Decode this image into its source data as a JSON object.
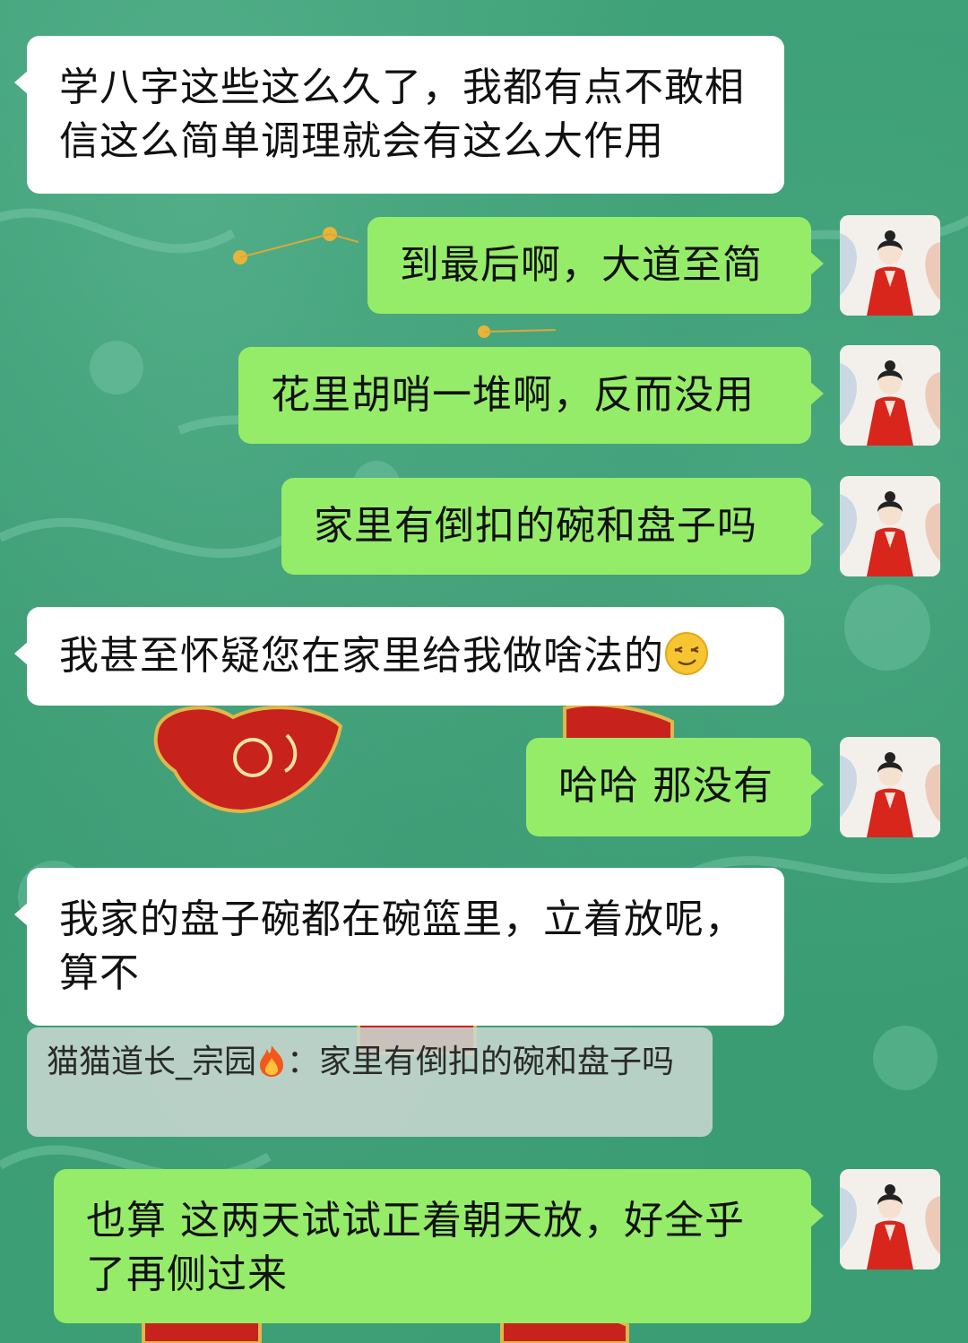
{
  "chat": {
    "messages": [
      {
        "side": "left",
        "text": "学八字这些这么久了，我都有点不敢相信这么简单调理就会有这么大作用"
      },
      {
        "side": "right",
        "text": "到最后啊，大道至简"
      },
      {
        "side": "right",
        "text": "花里胡哨一堆啊，反而没用"
      },
      {
        "side": "right",
        "text": "家里有倒扣的碗和盘子吗"
      },
      {
        "side": "left",
        "text": "我甚至怀疑您在家里给我做啥法的",
        "emoji": "smirk-emoji"
      },
      {
        "side": "right",
        "text": "哈哈 那没有"
      },
      {
        "side": "left",
        "text": "我家的盘子碗都在碗篮里，立着放呢，算不"
      },
      {
        "side": "right",
        "text": "也算 这两天试试正着朝天放，好全乎了再侧过来"
      }
    ],
    "quote": {
      "author": "猫猫道长_宗园",
      "author_icon": "fire-icon",
      "separator": "：",
      "text": "家里有倒扣的碗和盘子吗",
      "wrap_text": "子吗"
    }
  },
  "colors": {
    "background": "#3a9a72",
    "incoming_bubble": "#ffffff",
    "outgoing_bubble": "#95ec69"
  }
}
